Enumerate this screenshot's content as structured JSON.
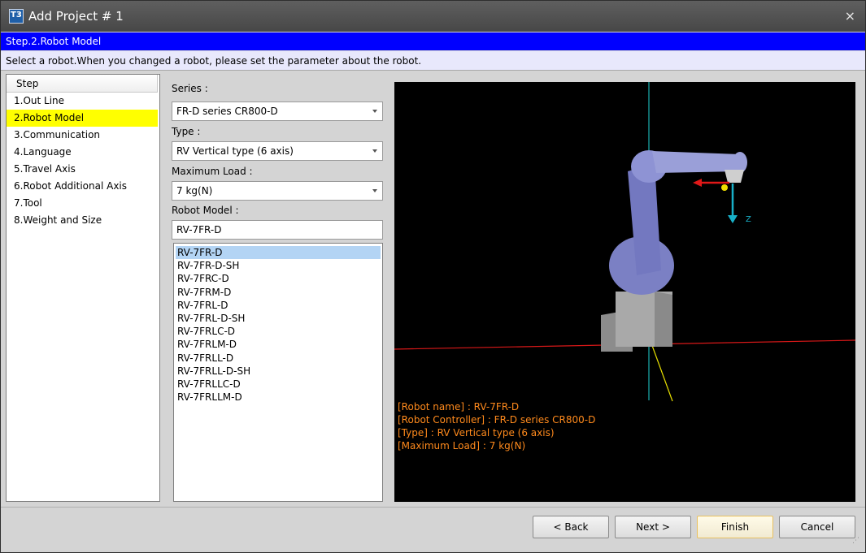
{
  "window": {
    "title": "Add Project # 1",
    "close_glyph": "×"
  },
  "stepbar": {
    "text": "Step.2.Robot Model"
  },
  "instruction": {
    "text": "Select a robot.When you changed a robot, please set the parameter about the robot."
  },
  "steps": {
    "header": "Step",
    "items": [
      {
        "label": "1.Out Line",
        "active": false
      },
      {
        "label": "2.Robot Model",
        "active": true
      },
      {
        "label": "3.Communication",
        "active": false
      },
      {
        "label": "4.Language",
        "active": false
      },
      {
        "label": "5.Travel Axis",
        "active": false
      },
      {
        "label": "6.Robot Additional Axis",
        "active": false
      },
      {
        "label": "7.Tool",
        "active": false
      },
      {
        "label": "8.Weight and Size",
        "active": false
      }
    ]
  },
  "form": {
    "series_label": "Series :",
    "series_value": "FR-D series CR800-D",
    "type_label": "Type :",
    "type_value": "RV Vertical type (6 axis)",
    "load_label": "Maximum Load :",
    "load_value": "7 kg(N)",
    "model_label": "Robot Model :",
    "model_value": "RV-7FR-D"
  },
  "models": [
    "RV-7FR-D",
    "RV-7FR-D-SH",
    "RV-7FRC-D",
    "RV-7FRM-D",
    "RV-7FRL-D",
    "RV-7FRL-D-SH",
    "RV-7FRLC-D",
    "RV-7FRLM-D",
    "RV-7FRLL-D",
    "RV-7FRLL-D-SH",
    "RV-7FRLLC-D",
    "RV-7FRLLM-D"
  ],
  "selected_model_index": 0,
  "viewport": {
    "axis_label": "Z",
    "info": [
      "[Robot name] : RV-7FR-D",
      "[Robot Controller] : FR-D series CR800-D",
      "[Type] : RV Vertical type (6 axis)",
      "[Maximum Load] : 7 kg(N)"
    ],
    "info_color": "#ff8a1c"
  },
  "buttons": {
    "back": "< Back",
    "next": "Next >",
    "finish": "Finish",
    "cancel": "Cancel"
  },
  "colors": {
    "stepbar": "#0000ff",
    "active_step": "#ffff00",
    "list_selection": "#b3d4f4"
  }
}
